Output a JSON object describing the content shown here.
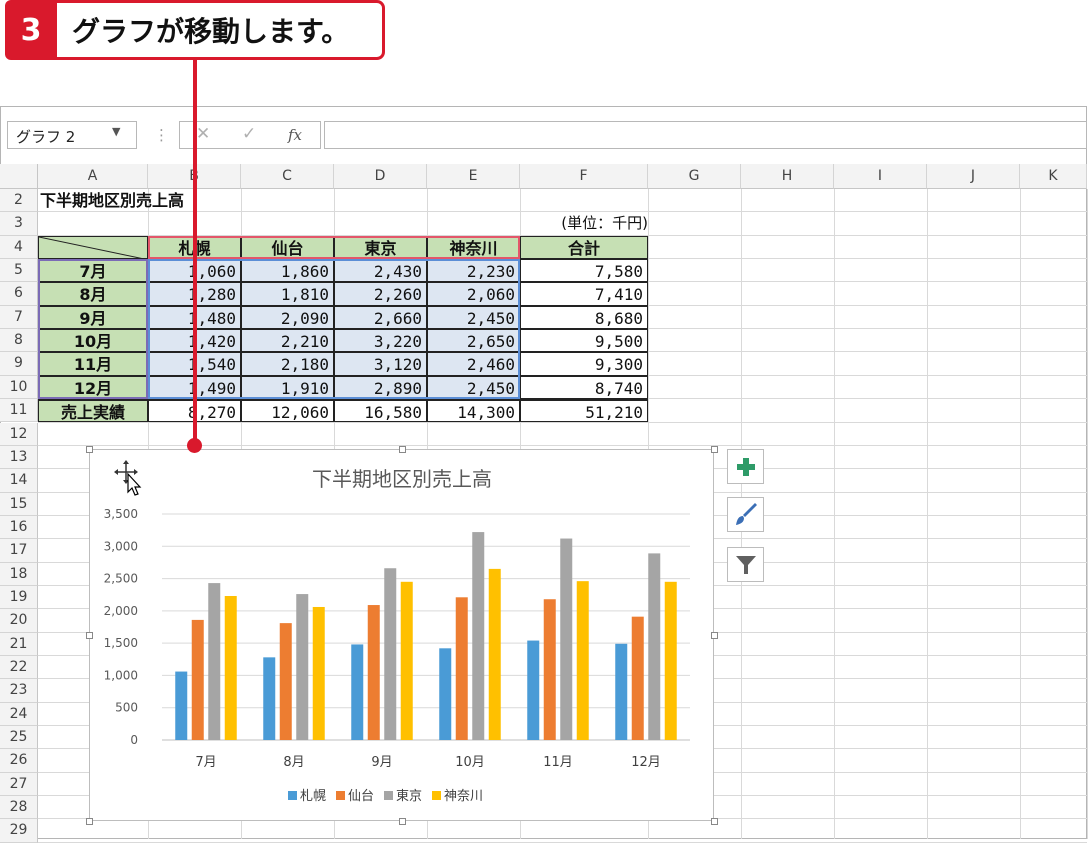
{
  "callout": {
    "step": "3",
    "text": "グラフが移動します。"
  },
  "formula_bar": {
    "name_box": "グラフ 2",
    "cancel_icon": "✕",
    "enter_icon": "✓",
    "fx_label": "fx",
    "value": ""
  },
  "columns": [
    "A",
    "B",
    "C",
    "D",
    "E",
    "F",
    "G",
    "H",
    "I",
    "J",
    "K"
  ],
  "rows": [
    "2",
    "3",
    "4",
    "5",
    "6",
    "7",
    "8",
    "9",
    "10",
    "11",
    "12",
    "13",
    "14",
    "15",
    "16",
    "17",
    "18",
    "19",
    "20",
    "21",
    "22",
    "23",
    "24",
    "25",
    "26",
    "27",
    "28",
    "29"
  ],
  "sheet": {
    "title": "下半期地区別売上高",
    "unit": "(単位：千円)",
    "headers": [
      "札幌",
      "仙台",
      "東京",
      "神奈川",
      "合計"
    ],
    "table_rows": [
      {
        "label": "7月",
        "values": [
          "1,060",
          "1,860",
          "2,430",
          "2,230",
          "7,580"
        ]
      },
      {
        "label": "8月",
        "values": [
          "1,280",
          "1,810",
          "2,260",
          "2,060",
          "7,410"
        ]
      },
      {
        "label": "9月",
        "values": [
          "1,480",
          "2,090",
          "2,660",
          "2,450",
          "8,680"
        ]
      },
      {
        "label": "10月",
        "values": [
          "1,420",
          "2,210",
          "3,220",
          "2,650",
          "9,500"
        ]
      },
      {
        "label": "11月",
        "values": [
          "1,540",
          "2,180",
          "3,120",
          "2,460",
          "9,300"
        ]
      },
      {
        "label": "12月",
        "values": [
          "1,490",
          "1,910",
          "2,890",
          "2,450",
          "8,740"
        ]
      }
    ],
    "total_row": {
      "label": "売上実績",
      "values": [
        "8,270",
        "12,060",
        "16,580",
        "14,300",
        "51,210"
      ]
    }
  },
  "side_buttons": [
    {
      "name": "chart-elements-button",
      "icon": "plus-icon"
    },
    {
      "name": "chart-styles-button",
      "icon": "brush-icon"
    },
    {
      "name": "chart-filters-button",
      "icon": "filter-icon"
    }
  ],
  "colors": {
    "sapporo": "#4a9bd6",
    "sendai": "#ed7d31",
    "tokyo": "#a5a5a5",
    "kanagawa": "#ffc000",
    "accent_red": "#d9192c",
    "header_green": "#c6e0b4",
    "range_blue": "#dde6f2"
  },
  "chart_data": {
    "type": "bar",
    "title": "下半期地区別売上高",
    "categories": [
      "7月",
      "8月",
      "9月",
      "10月",
      "11月",
      "12月"
    ],
    "series": [
      {
        "name": "札幌",
        "values": [
          1060,
          1280,
          1480,
          1420,
          1540,
          1490
        ]
      },
      {
        "name": "仙台",
        "values": [
          1860,
          1810,
          2090,
          2210,
          2180,
          1910
        ]
      },
      {
        "name": "東京",
        "values": [
          2430,
          2260,
          2660,
          3220,
          3120,
          2890
        ]
      },
      {
        "name": "神奈川",
        "values": [
          2230,
          2060,
          2450,
          2650,
          2460,
          2450
        ]
      }
    ],
    "ylim": [
      0,
      3500
    ],
    "yticks": [
      "0",
      "500",
      "1,000",
      "1,500",
      "2,000",
      "2,500",
      "3,000",
      "3,500"
    ],
    "grid": true,
    "legend": "bottom"
  }
}
